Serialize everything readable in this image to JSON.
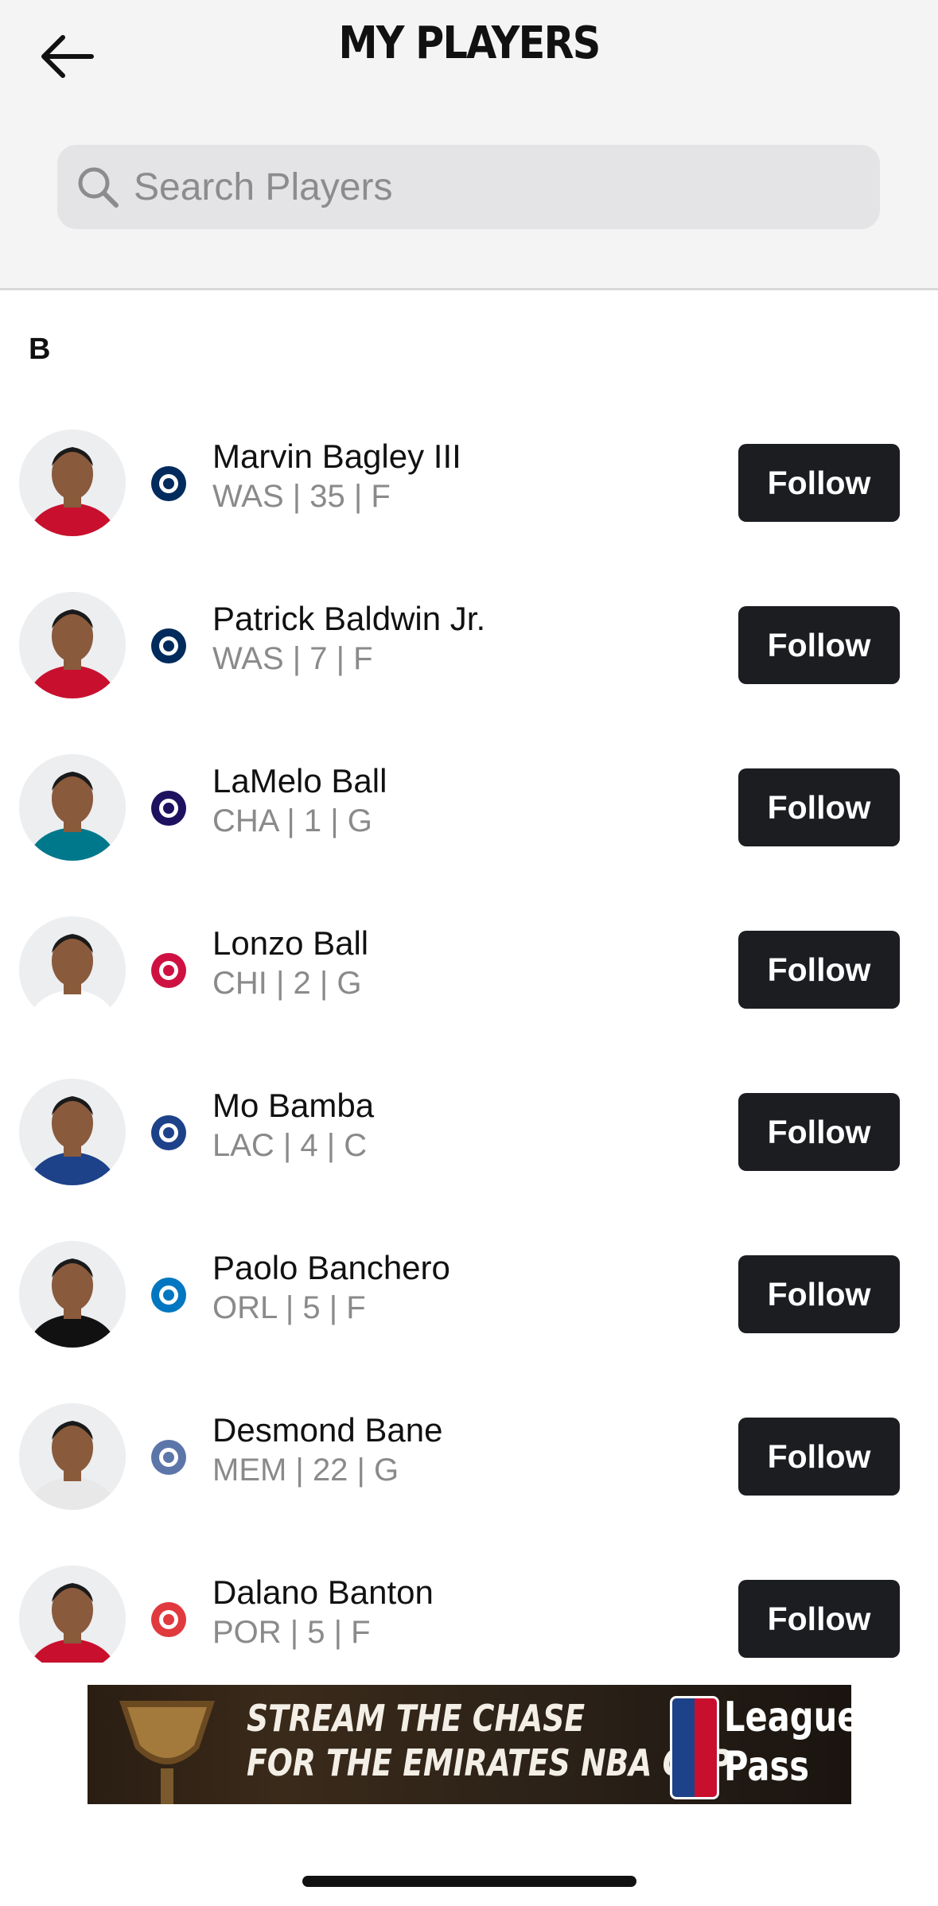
{
  "header": {
    "title": "MY PLAYERS",
    "search_placeholder": "Search Players"
  },
  "section_letter": "B",
  "follow_label": "Follow",
  "players": [
    {
      "name": "Marvin Bagley III",
      "info": "WAS | 35 | F",
      "team": "WAS",
      "team_color": "#002B5C",
      "jersey_color": "#c8102e"
    },
    {
      "name": "Patrick Baldwin Jr.",
      "info": "WAS | 7 | F",
      "team": "WAS",
      "team_color": "#002B5C",
      "jersey_color": "#c8102e"
    },
    {
      "name": "LaMelo Ball",
      "info": "CHA | 1 | G",
      "team": "CHA",
      "team_color": "#1d1160",
      "jersey_color": "#00788C"
    },
    {
      "name": "Lonzo Ball",
      "info": "CHI | 2 | G",
      "team": "CHI",
      "team_color": "#CE1141",
      "jersey_color": "#ffffff"
    },
    {
      "name": "Mo Bamba",
      "info": "LAC | 4 | C",
      "team": "LAC",
      "team_color": "#1D428A",
      "jersey_color": "#1D428A"
    },
    {
      "name": "Paolo Banchero",
      "info": "ORL | 5 | F",
      "team": "ORL",
      "team_color": "#0077C0",
      "jersey_color": "#111111"
    },
    {
      "name": "Desmond Bane",
      "info": "MEM | 22 | G",
      "team": "MEM",
      "team_color": "#5D76A9",
      "jersey_color": "#e8e8e8"
    },
    {
      "name": "Dalano Banton",
      "info": "POR | 5 | F",
      "team": "POR",
      "team_color": "#E03A3E",
      "jersey_color": "#c8102e"
    }
  ],
  "ad": {
    "line1": "STREAM THE CHASE",
    "line2": "FOR THE EMIRATES NBA CUP",
    "brand_line1": "League",
    "brand_line2": "Pass"
  },
  "icons": {
    "back": "arrow-left-icon",
    "search": "magnifier-icon"
  }
}
